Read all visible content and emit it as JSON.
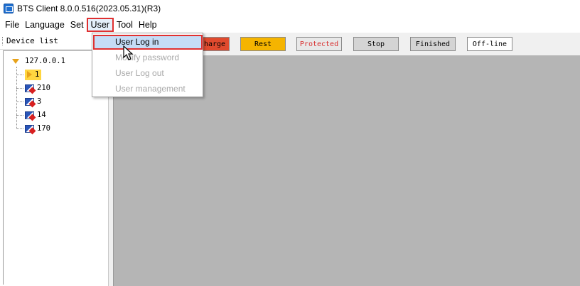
{
  "window": {
    "title": "BTS Client 8.0.0.516(2023.05.31)(R3)"
  },
  "menu": [
    "File",
    "Language",
    "Set",
    "User",
    "Tool",
    "Help"
  ],
  "sidebar": {
    "header": "Device list",
    "root": "127.0.0.1",
    "items": [
      "1",
      "210",
      "3",
      "14",
      "170"
    ]
  },
  "toolbar": {
    "statuses": [
      {
        "label": "harge",
        "bg": "#e04a2e",
        "fg": "#000000"
      },
      {
        "label": "Rest",
        "bg": "#f5b400",
        "fg": "#000000"
      },
      {
        "label": "Protected",
        "bg": "#e8e8e8",
        "fg": "#d83030"
      },
      {
        "label": "Stop",
        "bg": "#d4d4d4",
        "fg": "#000000"
      },
      {
        "label": "Finished",
        "bg": "#d4d4d4",
        "fg": "#000000"
      },
      {
        "label": "Off-line",
        "bg": "#ffffff",
        "fg": "#000000"
      }
    ]
  },
  "user_menu": {
    "items": [
      {
        "label": "User Log in",
        "enabled": true
      },
      {
        "label": "Modify password",
        "enabled": false
      },
      {
        "label": "User Log out",
        "enabled": false
      },
      {
        "label": "User management",
        "enabled": false
      }
    ]
  },
  "colors": {
    "highlight_border": "#e03030",
    "workspace": "#b5b5b5",
    "selected_node": "#ffd640"
  }
}
